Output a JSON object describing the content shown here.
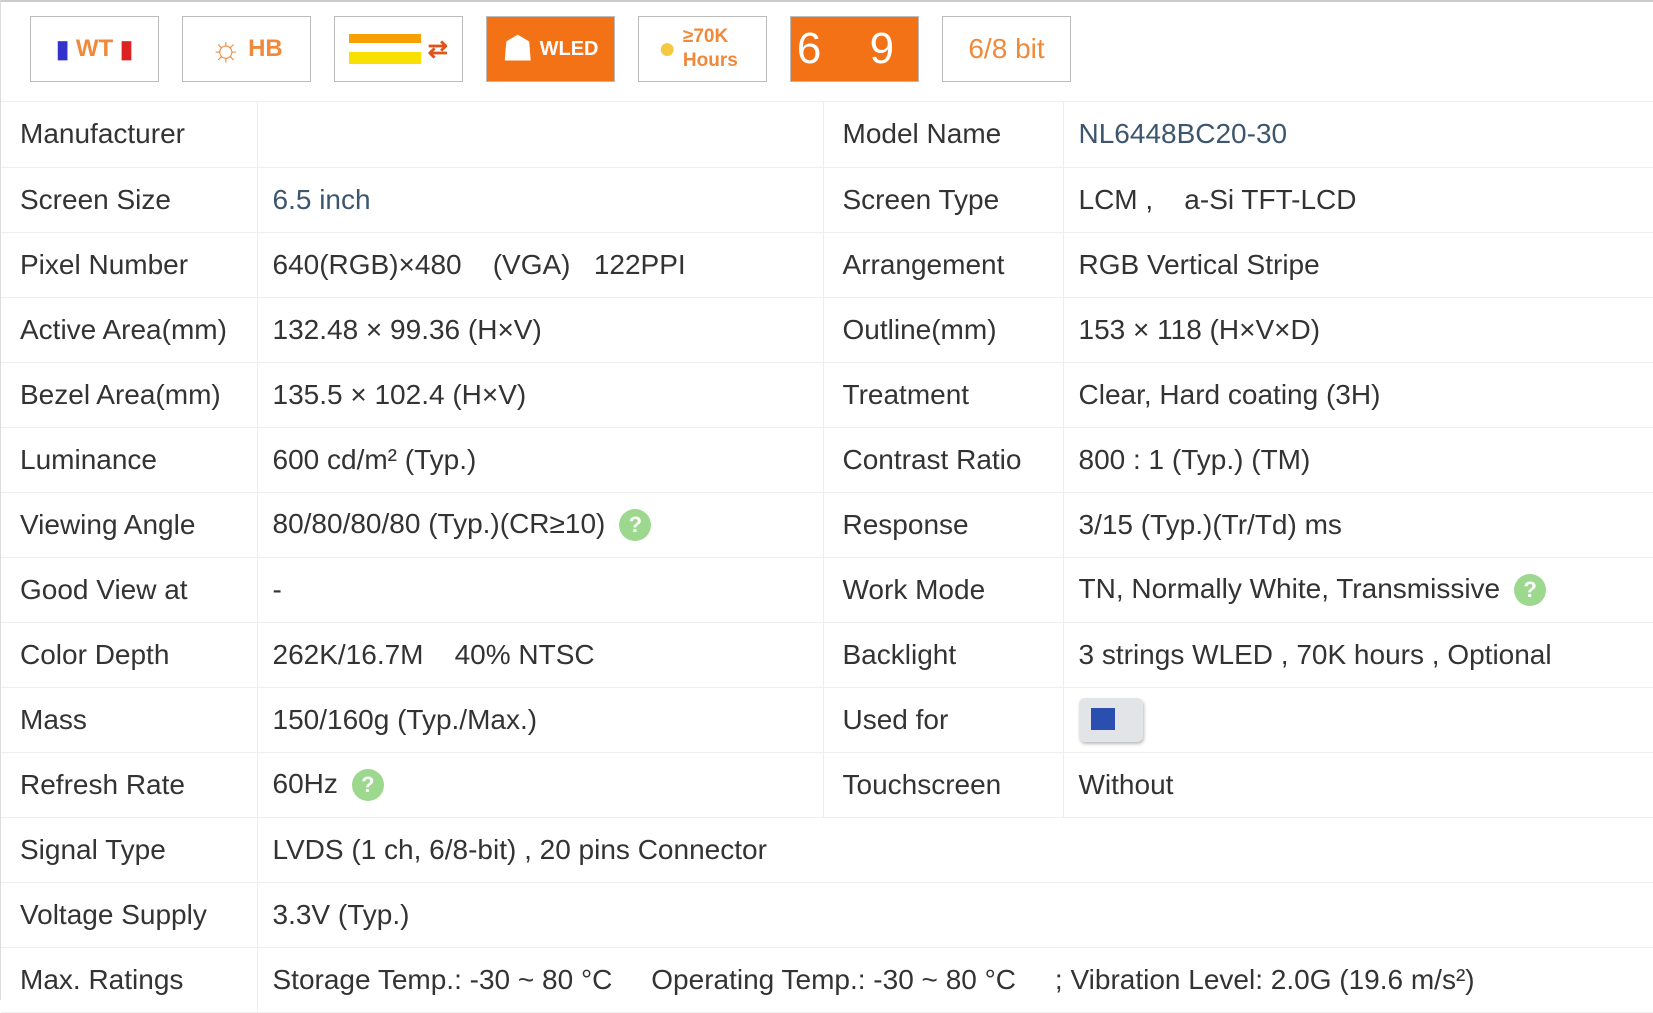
{
  "badges": [
    {
      "name": "wide-temperature-badge",
      "label": "WT"
    },
    {
      "name": "high-brightness-badge",
      "label": "HB"
    },
    {
      "name": "lvds-interface-badge",
      "label": "⇄"
    },
    {
      "name": "wled-badge",
      "label": "WLED"
    },
    {
      "name": "lifetime-badge",
      "label": "≥70K Hours"
    },
    {
      "name": "viewing-direction-badge",
      "label": "6 9"
    },
    {
      "name": "color-depth-badge",
      "label": "6/8 bit"
    }
  ],
  "rows": [
    [
      "Manufacturer",
      "",
      "Model Name",
      "NL6448BC20-30"
    ],
    [
      "Screen Size",
      "6.5 inch",
      "Screen Type",
      "LCM ,    a-Si TFT-LCD"
    ],
    [
      "Pixel Number",
      "640(RGB)×480    (VGA)   122PPI",
      "Arrangement",
      "RGB Vertical Stripe"
    ],
    [
      "Active Area(mm)",
      "132.48 × 99.36 (H×V)",
      "Outline(mm)",
      "153 × 118 (H×V×D)"
    ],
    [
      "Bezel Area(mm)",
      "135.5 × 102.4 (H×V)",
      "Treatment",
      "Clear, Hard coating (3H)"
    ],
    [
      "Luminance",
      "600 cd/m² (Typ.)",
      "Contrast Ratio",
      "800 : 1 (Typ.) (TM)"
    ],
    [
      "Viewing Angle",
      "80/80/80/80 (Typ.)(CR≥10)",
      "Response",
      "3/15 (Typ.)(Tr/Td) ms"
    ],
    [
      "Good View at",
      "-",
      "Work Mode",
      "TN, Normally White, Transmissive"
    ],
    [
      "Color Depth",
      "262K/16.7M    40% NTSC",
      "Backlight",
      "3 strings WLED , 70K hours , Optional"
    ],
    [
      "Mass",
      "150/160g (Typ./Max.)",
      "Used for",
      ""
    ],
    [
      "Refresh Rate",
      "60Hz",
      "Touchscreen",
      "Without"
    ]
  ],
  "wide_rows": [
    [
      "Signal Type",
      "LVDS (1 ch, 6/8-bit) , 20 pins Connector"
    ],
    [
      "Voltage Supply",
      "3.3V (Typ.)"
    ],
    [
      "Max. Ratings",
      "Storage Temp.: -30 ~ 80 °C     Operating Temp.: -30 ~ 80 °C     ; Vibration Level: 2.0G (19.6 m/s²)"
    ]
  ],
  "help_label": "?"
}
